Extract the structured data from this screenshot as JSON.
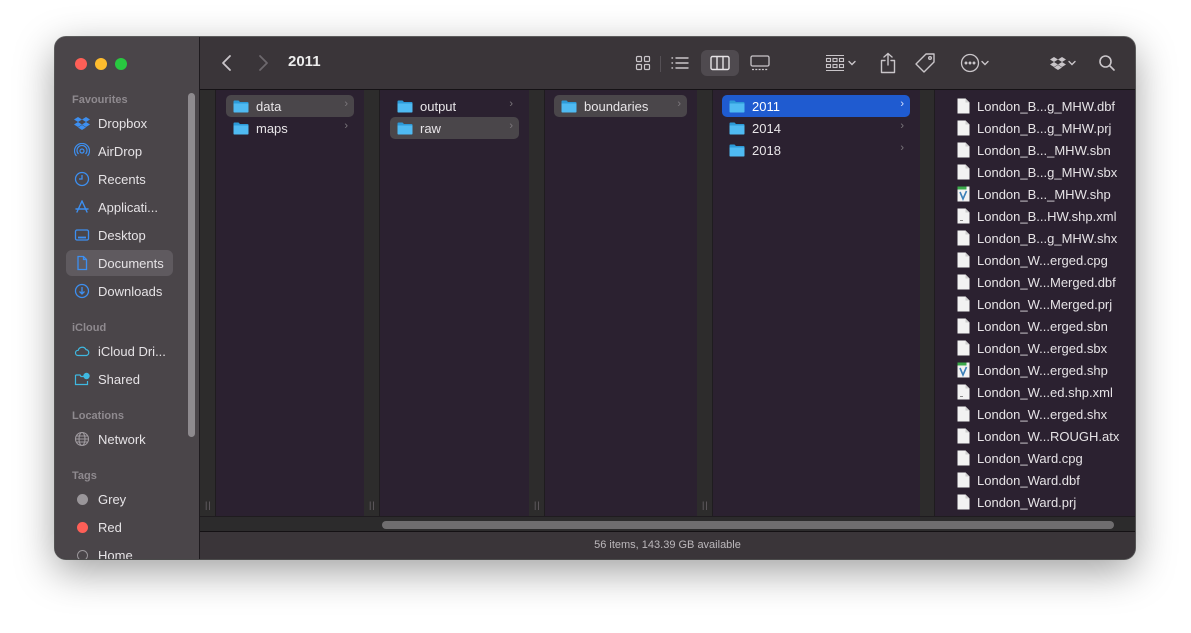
{
  "window": {
    "title": "2011",
    "traffic_lights": {
      "close": "#fe5f57",
      "minimize": "#febc2e",
      "maximize": "#28c840"
    }
  },
  "toolbar": {
    "back_icon": "chevron-left",
    "forward_icon": "chevron-right",
    "views": [
      "icon-view",
      "list-view",
      "column-view",
      "gallery-view"
    ],
    "active_view": "column-view",
    "actions": [
      "group-by",
      "share",
      "tags",
      "more-actions",
      "dropbox",
      "search"
    ]
  },
  "sidebar": {
    "sections": [
      {
        "label": "Favourites",
        "items": [
          {
            "label": "Dropbox",
            "icon": "dropbox-icon"
          },
          {
            "label": "AirDrop",
            "icon": "airdrop-icon"
          },
          {
            "label": "Recents",
            "icon": "clock-icon"
          },
          {
            "label": "Applicati...",
            "icon": "applications-icon"
          },
          {
            "label": "Desktop",
            "icon": "desktop-icon"
          },
          {
            "label": "Documents",
            "icon": "document-icon",
            "active": true
          },
          {
            "label": "Downloads",
            "icon": "download-icon"
          }
        ]
      },
      {
        "label": "iCloud",
        "items": [
          {
            "label": "iCloud Dri...",
            "icon": "cloud-icon"
          },
          {
            "label": "Shared",
            "icon": "shared-folder-icon"
          }
        ]
      },
      {
        "label": "Locations",
        "items": [
          {
            "label": "Network",
            "icon": "globe-icon"
          }
        ]
      },
      {
        "label": "Tags",
        "items": [
          {
            "label": "Grey",
            "color": "#9a969a"
          },
          {
            "label": "Red",
            "color": "#fe5f57"
          },
          {
            "label": "Home",
            "color": "transparent"
          }
        ]
      }
    ]
  },
  "columns": [
    {
      "items": [
        {
          "name": "data",
          "selected": "grey"
        },
        {
          "name": "maps"
        }
      ]
    },
    {
      "items": [
        {
          "name": "output"
        },
        {
          "name": "raw",
          "selected": "grey"
        }
      ]
    },
    {
      "items": [
        {
          "name": "boundaries",
          "selected": "grey"
        }
      ]
    },
    {
      "items": [
        {
          "name": "2011",
          "selected": "blue"
        },
        {
          "name": "2014"
        },
        {
          "name": "2018"
        }
      ]
    }
  ],
  "files": [
    {
      "name": "London_B...g_MHW.dbf",
      "type": "doc"
    },
    {
      "name": "London_B...g_MHW.prj",
      "type": "doc"
    },
    {
      "name": "London_B..._MHW.sbn",
      "type": "doc"
    },
    {
      "name": "London_B...g_MHW.sbx",
      "type": "doc"
    },
    {
      "name": "London_B..._MHW.shp",
      "type": "shp"
    },
    {
      "name": "London_B...HW.shp.xml",
      "type": "xml"
    },
    {
      "name": "London_B...g_MHW.shx",
      "type": "doc"
    },
    {
      "name": "London_W...erged.cpg",
      "type": "doc"
    },
    {
      "name": "London_W...Merged.dbf",
      "type": "doc"
    },
    {
      "name": "London_W...Merged.prj",
      "type": "doc"
    },
    {
      "name": "London_W...erged.sbn",
      "type": "doc"
    },
    {
      "name": "London_W...erged.sbx",
      "type": "doc"
    },
    {
      "name": "London_W...erged.shp",
      "type": "shp"
    },
    {
      "name": "London_W...ed.shp.xml",
      "type": "xml"
    },
    {
      "name": "London_W...erged.shx",
      "type": "doc"
    },
    {
      "name": "London_W...ROUGH.atx",
      "type": "doc"
    },
    {
      "name": "London_Ward.cpg",
      "type": "doc"
    },
    {
      "name": "London_Ward.dbf",
      "type": "doc"
    },
    {
      "name": "London_Ward.prj",
      "type": "doc"
    }
  ],
  "status": {
    "text": "56 items, 143.39 GB available"
  },
  "colors": {
    "selection_blue": "#1f5bd0",
    "folder_blue": "#3fb2ee",
    "sidebar_icon_blue": "#3d8ff0"
  }
}
